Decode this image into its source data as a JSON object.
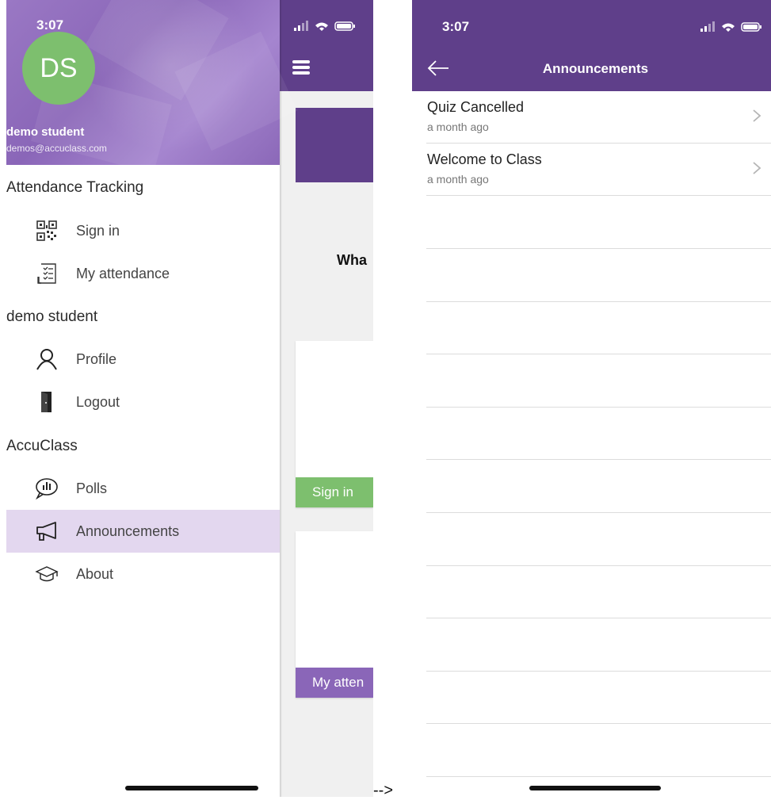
{
  "left": {
    "status_time": "3:07",
    "avatar_initials": "DS",
    "user_name": "demo student",
    "user_email": "demos@accuclass.com",
    "sections": [
      {
        "title": "Attendance Tracking",
        "items": [
          {
            "label": "Sign in",
            "icon": "qr-code-icon"
          },
          {
            "label": "My attendance",
            "icon": "checklist-icon"
          }
        ]
      },
      {
        "title": "demo student",
        "items": [
          {
            "label": "Profile",
            "icon": "person-icon"
          },
          {
            "label": "Logout",
            "icon": "door-icon"
          }
        ]
      },
      {
        "title": "AccuClass",
        "items": [
          {
            "label": "Polls",
            "icon": "poll-bubble-icon"
          },
          {
            "label": "Announcements",
            "icon": "megaphone-icon",
            "active": true
          },
          {
            "label": "About",
            "icon": "graduation-cap-icon"
          }
        ]
      }
    ],
    "behind": {
      "partial_heading": "Wha",
      "card1_footer": "Sign in",
      "card2_footer": "My atten"
    }
  },
  "arrow_text": "-->",
  "right": {
    "status_time": "3:07",
    "title": "Announcements",
    "announcements": [
      {
        "title": "Quiz Cancelled",
        "time": "a month ago"
      },
      {
        "title": "Welcome to Class",
        "time": "a month ago"
      }
    ]
  },
  "colors": {
    "primary_purple": "#5f3f8a",
    "drawer_header": "#9a78c4",
    "avatar_green": "#7dbf6e",
    "active_item": "#e3d7ef",
    "sign_in_green": "#7dbf6e",
    "attendance_purple": "#8a66b8"
  }
}
